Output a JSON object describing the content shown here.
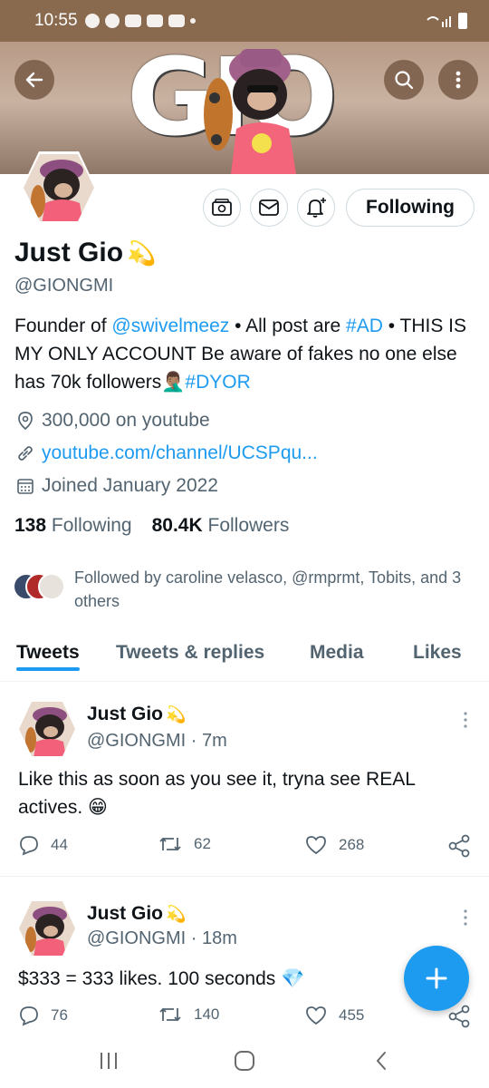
{
  "status_bar": {
    "time": "10:55"
  },
  "banner": {
    "word": "GIO"
  },
  "profile": {
    "display_name": "Just Gio",
    "name_emoji": "💫",
    "handle": "@GIONGMI",
    "bio": {
      "p1": "Founder of ",
      "mention": "@swivelmeez",
      "p2": " • All post are ",
      "tag1": "#AD",
      "p3": " • THIS IS MY ONLY ACCOUNT Be aware of fakes no one else has 70k followers",
      "emoji": "🤦🏽‍♂️",
      "tag2": "#DYOR"
    },
    "location": "300,000 on youtube",
    "website": "youtube.com/channel/UCSPqu...",
    "joined": "Joined January 2022",
    "following_count": "138",
    "following_label": "Following",
    "followers_count": "80.4K",
    "followers_label": "Followers",
    "followed_by": "Followed by caroline velasco, @rmprmt, Tobits, and 3 others",
    "follow_button": "Following"
  },
  "tabs": [
    "Tweets",
    "Tweets & replies",
    "Media",
    "Likes"
  ],
  "tweets": [
    {
      "name": "Just Gio",
      "name_emoji": "💫",
      "handle": "@GIONGMI · 7m",
      "text": "Like this as soon as you see it, tryna see REAL actives. 😁",
      "replies": "44",
      "retweets": "62",
      "likes": "268"
    },
    {
      "name": "Just Gio",
      "name_emoji": "💫",
      "handle": "@GIONGMI · 18m",
      "text": "$333 = 333 likes. 100 seconds 💎",
      "replies": "76",
      "retweets": "140",
      "likes": "455"
    }
  ],
  "colors": {
    "accent": "#1d9bf0",
    "status_bar": "#8a6a4f"
  }
}
